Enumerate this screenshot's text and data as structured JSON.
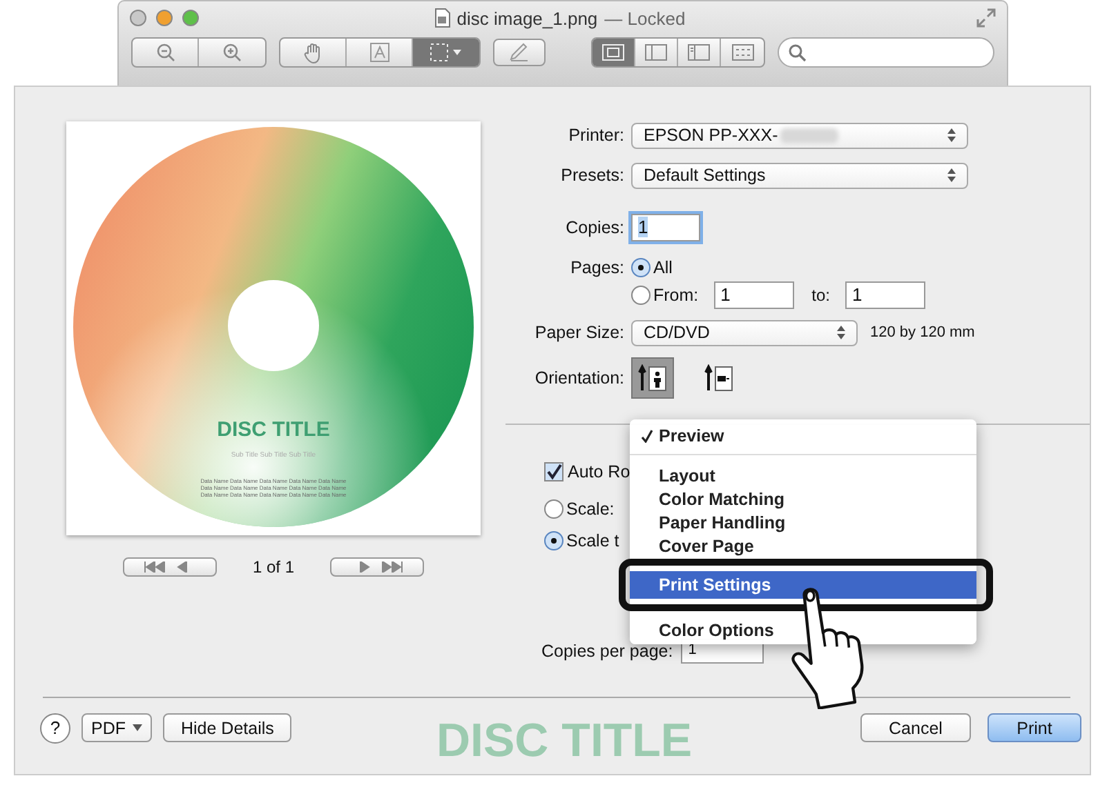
{
  "window": {
    "title": "disc image_1.png",
    "status": "— Locked"
  },
  "toolbar": {
    "zoom": [
      {
        "kind": "zoomout"
      },
      {
        "kind": "zoomin"
      }
    ],
    "tools": [
      {
        "kind": "hand",
        "selected": false
      },
      {
        "kind": "text",
        "selected": false
      },
      {
        "kind": "select",
        "selected": true
      }
    ],
    "views": [
      {
        "kind": "content",
        "selected": true
      },
      {
        "kind": "sidebar",
        "selected": false
      },
      {
        "kind": "panel",
        "selected": false
      },
      {
        "kind": "grid",
        "selected": false
      }
    ]
  },
  "preview": {
    "disc_title": "DISC TITLE",
    "disc_subtitle": "Sub Title Sub Title Sub Title",
    "data_lines": [
      "Data Name Data Name Data Name Data Name Data Name",
      "Data Name Data Name Data Name Data Name Data Name",
      "Data Name Data Name Data Name Data Name Data Name"
    ],
    "page_indicator": "1 of 1"
  },
  "printer": {
    "label": "Printer:",
    "value": "EPSON PP-XXX-"
  },
  "presets": {
    "label": "Presets:",
    "value": "Default Settings"
  },
  "copies": {
    "label": "Copies:",
    "value": "1"
  },
  "pages": {
    "label": "Pages:",
    "options": [
      {
        "label": "All",
        "selected": true
      },
      {
        "label": "From:",
        "selected": false
      }
    ],
    "from": "1",
    "to_label": "to:",
    "to": "1"
  },
  "paper_size": {
    "label": "Paper Size:",
    "value": "CD/DVD",
    "note": "120 by 120 mm"
  },
  "orientation": {
    "label": "Orientation:",
    "options": [
      {
        "kind": "portrait",
        "selected": true
      },
      {
        "kind": "landscape",
        "selected": false
      }
    ]
  },
  "auto_rotate": {
    "label": "Auto Ro",
    "checked": true
  },
  "scale": [
    {
      "label": "Scale:",
      "selected": false
    },
    {
      "label": "Scale t",
      "selected": true
    }
  ],
  "copies_per_page": {
    "label": "Copies per page:",
    "value": "1"
  },
  "menu": {
    "sections": [
      [
        {
          "label": "Preview",
          "checked": true,
          "selected": false
        }
      ],
      [
        {
          "label": "Layout",
          "checked": false,
          "selected": false
        },
        {
          "label": "Color Matching",
          "checked": false,
          "selected": false
        },
        {
          "label": "Paper Handling",
          "checked": false,
          "selected": false
        },
        {
          "label": "Cover Page",
          "checked": false,
          "selected": false
        },
        {
          "label": "Print Settings",
          "checked": false,
          "selected": true
        },
        {
          "label": "Color Options",
          "checked": false,
          "selected": false
        }
      ]
    ]
  },
  "footer": {
    "help": "?",
    "pdf": "PDF",
    "hide_details": "Hide Details",
    "cancel": "Cancel",
    "print": "Print"
  },
  "background_title": "DISC TITLE"
}
